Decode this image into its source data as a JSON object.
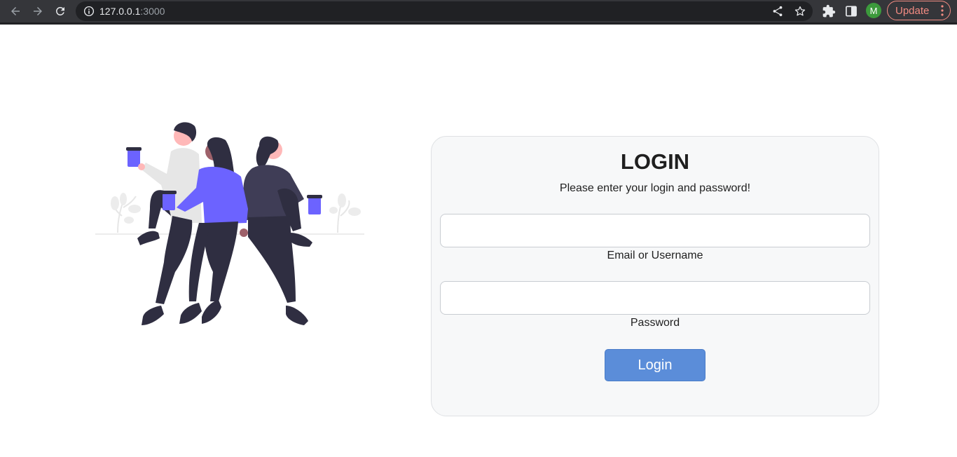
{
  "browser": {
    "url_host": "127.0.0.1",
    "url_port": ":3000",
    "profile_initial": "M",
    "update_label": "Update"
  },
  "login": {
    "title": "LOGIN",
    "subtitle": "Please enter your login and password!",
    "email_label": "Email or Username",
    "email_value": "",
    "password_label": "Password",
    "password_value": "",
    "button_label": "Login"
  },
  "colors": {
    "accent": "#5b8dd9",
    "illustration_purple": "#6c63ff",
    "illustration_dark": "#2f2e41"
  }
}
